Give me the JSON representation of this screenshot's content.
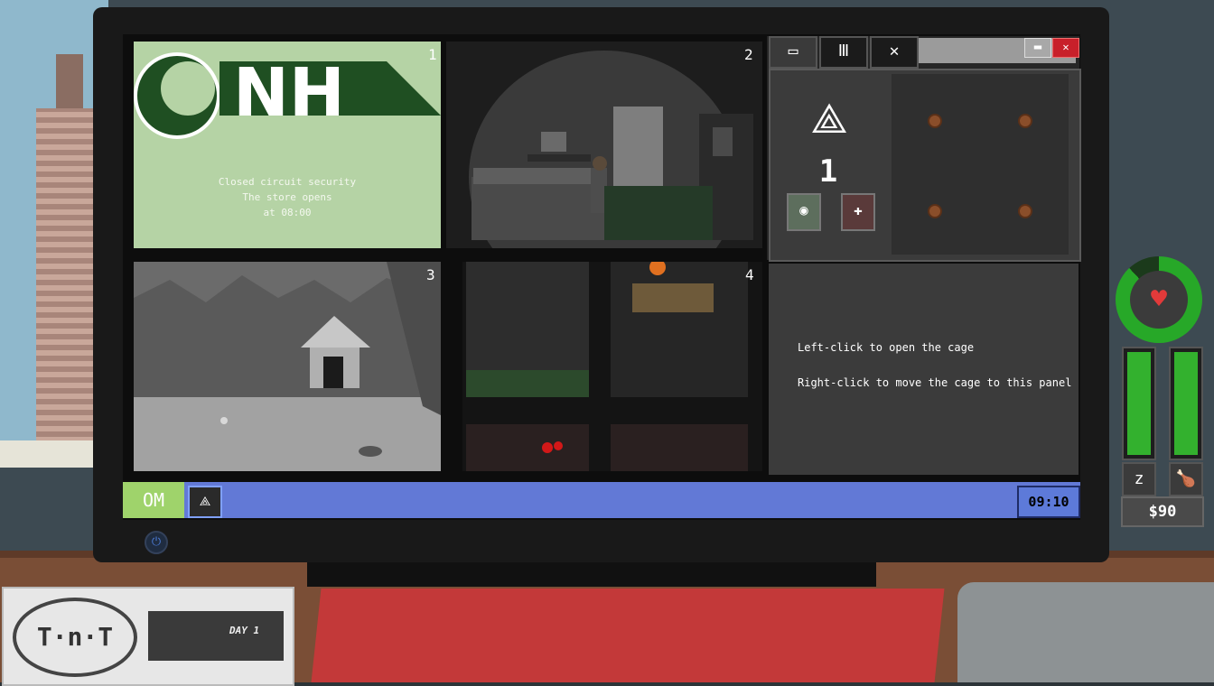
{
  "panels": {
    "p1": {
      "number": "1",
      "logo_text": "NH",
      "message_lines": [
        "Closed circuit security",
        "The store opens",
        "at 08:00"
      ]
    },
    "p2": {
      "number": "2"
    },
    "p3": {
      "number": "3"
    },
    "p4": {
      "number": "4"
    }
  },
  "app": {
    "tabs": [
      {
        "name": "camera-tab",
        "icon": "camera-icon"
      },
      {
        "name": "shop-tab",
        "icon": "shop-icon"
      },
      {
        "name": "close-tab",
        "icon": "close-icon"
      }
    ],
    "level": "1",
    "grid_items": 4
  },
  "info": {
    "line1": "Left-click to open the cage",
    "line2": "Right-click to move the cage to this panel"
  },
  "taskbar": {
    "start_label": "OM",
    "clock": "09:10"
  },
  "status": {
    "health_ring": 0.88,
    "sleep_bar": 1.0,
    "food_bar": 1.0,
    "money": "$90"
  },
  "desk": {
    "paper_day": "DAY 1",
    "paper_logo": "T·n·T"
  },
  "colors": {
    "accent_green": "#27a828",
    "taskbar_blue": "#6279d6",
    "close_red": "#c8202a"
  }
}
